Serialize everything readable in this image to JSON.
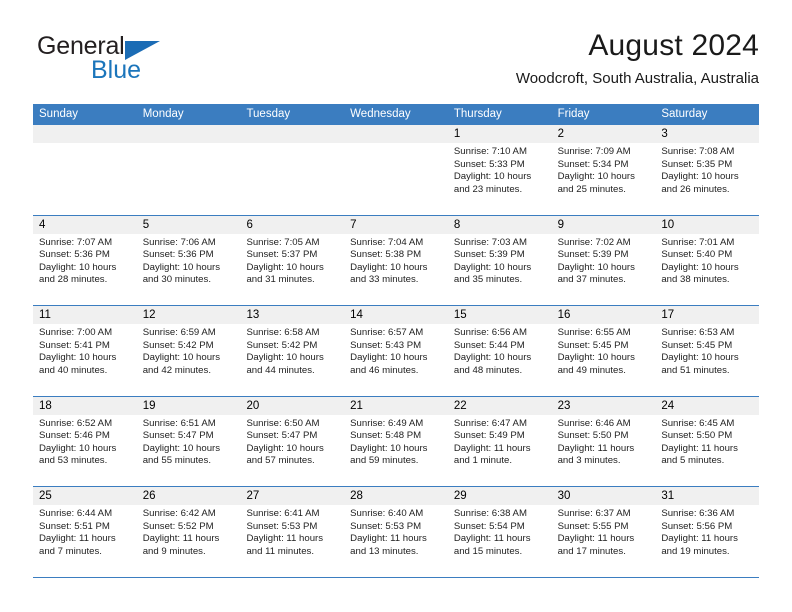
{
  "brand": {
    "name_top": "General",
    "name_bottom": "Blue",
    "triangle_color": "#1b6cb5",
    "blue_text_color": "#1b75bb"
  },
  "header": {
    "title": "August 2024",
    "subtitle": "Woodcroft, South Australia, Australia",
    "header_bg_color": "#3b7dc0",
    "header_text_color": "#ffffff"
  },
  "weekdays": [
    "Sunday",
    "Monday",
    "Tuesday",
    "Wednesday",
    "Thursday",
    "Friday",
    "Saturday"
  ],
  "weeks": [
    [
      {
        "day": "",
        "lines": []
      },
      {
        "day": "",
        "lines": []
      },
      {
        "day": "",
        "lines": []
      },
      {
        "day": "",
        "lines": []
      },
      {
        "day": "1",
        "lines": [
          "Sunrise: 7:10 AM",
          "Sunset: 5:33 PM",
          "Daylight: 10 hours",
          "and 23 minutes."
        ]
      },
      {
        "day": "2",
        "lines": [
          "Sunrise: 7:09 AM",
          "Sunset: 5:34 PM",
          "Daylight: 10 hours",
          "and 25 minutes."
        ]
      },
      {
        "day": "3",
        "lines": [
          "Sunrise: 7:08 AM",
          "Sunset: 5:35 PM",
          "Daylight: 10 hours",
          "and 26 minutes."
        ]
      }
    ],
    [
      {
        "day": "4",
        "lines": [
          "Sunrise: 7:07 AM",
          "Sunset: 5:36 PM",
          "Daylight: 10 hours",
          "and 28 minutes."
        ]
      },
      {
        "day": "5",
        "lines": [
          "Sunrise: 7:06 AM",
          "Sunset: 5:36 PM",
          "Daylight: 10 hours",
          "and 30 minutes."
        ]
      },
      {
        "day": "6",
        "lines": [
          "Sunrise: 7:05 AM",
          "Sunset: 5:37 PM",
          "Daylight: 10 hours",
          "and 31 minutes."
        ]
      },
      {
        "day": "7",
        "lines": [
          "Sunrise: 7:04 AM",
          "Sunset: 5:38 PM",
          "Daylight: 10 hours",
          "and 33 minutes."
        ]
      },
      {
        "day": "8",
        "lines": [
          "Sunrise: 7:03 AM",
          "Sunset: 5:39 PM",
          "Daylight: 10 hours",
          "and 35 minutes."
        ]
      },
      {
        "day": "9",
        "lines": [
          "Sunrise: 7:02 AM",
          "Sunset: 5:39 PM",
          "Daylight: 10 hours",
          "and 37 minutes."
        ]
      },
      {
        "day": "10",
        "lines": [
          "Sunrise: 7:01 AM",
          "Sunset: 5:40 PM",
          "Daylight: 10 hours",
          "and 38 minutes."
        ]
      }
    ],
    [
      {
        "day": "11",
        "lines": [
          "Sunrise: 7:00 AM",
          "Sunset: 5:41 PM",
          "Daylight: 10 hours",
          "and 40 minutes."
        ]
      },
      {
        "day": "12",
        "lines": [
          "Sunrise: 6:59 AM",
          "Sunset: 5:42 PM",
          "Daylight: 10 hours",
          "and 42 minutes."
        ]
      },
      {
        "day": "13",
        "lines": [
          "Sunrise: 6:58 AM",
          "Sunset: 5:42 PM",
          "Daylight: 10 hours",
          "and 44 minutes."
        ]
      },
      {
        "day": "14",
        "lines": [
          "Sunrise: 6:57 AM",
          "Sunset: 5:43 PM",
          "Daylight: 10 hours",
          "and 46 minutes."
        ]
      },
      {
        "day": "15",
        "lines": [
          "Sunrise: 6:56 AM",
          "Sunset: 5:44 PM",
          "Daylight: 10 hours",
          "and 48 minutes."
        ]
      },
      {
        "day": "16",
        "lines": [
          "Sunrise: 6:55 AM",
          "Sunset: 5:45 PM",
          "Daylight: 10 hours",
          "and 49 minutes."
        ]
      },
      {
        "day": "17",
        "lines": [
          "Sunrise: 6:53 AM",
          "Sunset: 5:45 PM",
          "Daylight: 10 hours",
          "and 51 minutes."
        ]
      }
    ],
    [
      {
        "day": "18",
        "lines": [
          "Sunrise: 6:52 AM",
          "Sunset: 5:46 PM",
          "Daylight: 10 hours",
          "and 53 minutes."
        ]
      },
      {
        "day": "19",
        "lines": [
          "Sunrise: 6:51 AM",
          "Sunset: 5:47 PM",
          "Daylight: 10 hours",
          "and 55 minutes."
        ]
      },
      {
        "day": "20",
        "lines": [
          "Sunrise: 6:50 AM",
          "Sunset: 5:47 PM",
          "Daylight: 10 hours",
          "and 57 minutes."
        ]
      },
      {
        "day": "21",
        "lines": [
          "Sunrise: 6:49 AM",
          "Sunset: 5:48 PM",
          "Daylight: 10 hours",
          "and 59 minutes."
        ]
      },
      {
        "day": "22",
        "lines": [
          "Sunrise: 6:47 AM",
          "Sunset: 5:49 PM",
          "Daylight: 11 hours",
          "and 1 minute."
        ]
      },
      {
        "day": "23",
        "lines": [
          "Sunrise: 6:46 AM",
          "Sunset: 5:50 PM",
          "Daylight: 11 hours",
          "and 3 minutes."
        ]
      },
      {
        "day": "24",
        "lines": [
          "Sunrise: 6:45 AM",
          "Sunset: 5:50 PM",
          "Daylight: 11 hours",
          "and 5 minutes."
        ]
      }
    ],
    [
      {
        "day": "25",
        "lines": [
          "Sunrise: 6:44 AM",
          "Sunset: 5:51 PM",
          "Daylight: 11 hours",
          "and 7 minutes."
        ]
      },
      {
        "day": "26",
        "lines": [
          "Sunrise: 6:42 AM",
          "Sunset: 5:52 PM",
          "Daylight: 11 hours",
          "and 9 minutes."
        ]
      },
      {
        "day": "27",
        "lines": [
          "Sunrise: 6:41 AM",
          "Sunset: 5:53 PM",
          "Daylight: 11 hours",
          "and 11 minutes."
        ]
      },
      {
        "day": "28",
        "lines": [
          "Sunrise: 6:40 AM",
          "Sunset: 5:53 PM",
          "Daylight: 11 hours",
          "and 13 minutes."
        ]
      },
      {
        "day": "29",
        "lines": [
          "Sunrise: 6:38 AM",
          "Sunset: 5:54 PM",
          "Daylight: 11 hours",
          "and 15 minutes."
        ]
      },
      {
        "day": "30",
        "lines": [
          "Sunrise: 6:37 AM",
          "Sunset: 5:55 PM",
          "Daylight: 11 hours",
          "and 17 minutes."
        ]
      },
      {
        "day": "31",
        "lines": [
          "Sunrise: 6:36 AM",
          "Sunset: 5:56 PM",
          "Daylight: 11 hours",
          "and 19 minutes."
        ]
      }
    ]
  ]
}
